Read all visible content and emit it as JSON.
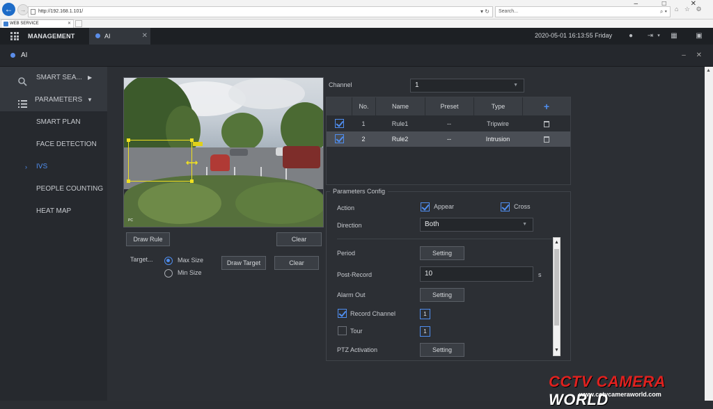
{
  "browser": {
    "address": "http://192.168.1.101/",
    "search_placeholder": "Search...",
    "tab_label": "WEB SERVICE",
    "tab_close": "✕",
    "win_controls": "– □ ✕",
    "addr_controls": "▾ ↻",
    "right_icons": "⌂ ☆ ⚙"
  },
  "header": {
    "management": "MANAGEMENT",
    "ai_tab": "AI",
    "ai_tab_close": "✕",
    "datetime": "2020-05-01 16:13:55 Friday"
  },
  "subheader": {
    "title": "AI",
    "controls": "– ✕"
  },
  "sidebar": {
    "smart_search": "SMART SEA...",
    "parameters": "PARAMETERS",
    "items": [
      {
        "label": "SMART PLAN"
      },
      {
        "label": "FACE DETECTION"
      },
      {
        "label": "IVS",
        "active": true
      },
      {
        "label": "PEOPLE COUNTING"
      },
      {
        "label": "HEAT MAP"
      }
    ]
  },
  "video": {
    "overlay_text": "PC",
    "move_glyph": "⟷"
  },
  "left_controls": {
    "draw_rule": "Draw Rule",
    "clear": "Clear",
    "target_label": "Target...",
    "max_size": "Max Size",
    "min_size": "Min Size",
    "draw_target": "Draw Target",
    "clear2": "Clear",
    "max_size_selected": true
  },
  "channel": {
    "label": "Channel",
    "value": "1"
  },
  "rules_table": {
    "columns": [
      "No.",
      "Name",
      "Preset",
      "Type"
    ],
    "add_icon": "+",
    "rows": [
      {
        "no": "1",
        "name": "Rule1",
        "preset": "--",
        "type": "Tripwire",
        "checked": true,
        "selected": false
      },
      {
        "no": "2",
        "name": "Rule2",
        "preset": "--",
        "type": "Intrusion",
        "checked": true,
        "selected": true
      }
    ]
  },
  "params": {
    "title": "Parameters Config",
    "action_label": "Action",
    "appear": "Appear",
    "cross": "Cross",
    "direction_label": "Direction",
    "direction_value": "Both",
    "period_label": "Period",
    "setting": "Setting",
    "post_record_label": "Post-Record",
    "post_record_value": "10",
    "post_record_unit": "s",
    "alarm_out_label": "Alarm Out",
    "record_channel_label": "Record Channel",
    "record_channel_value": "1",
    "tour_label": "Tour",
    "tour_value": "1",
    "ptz_label": "PTZ Activation"
  },
  "watermark": {
    "brand_a": "CCTV CAMERA ",
    "brand_b": "WORLD",
    "url": "www.cctvcameraworld.com"
  },
  "colors": {
    "accent": "#4f8ef0",
    "rule_box": "#f0e020",
    "brand_red": "#e0211f"
  }
}
